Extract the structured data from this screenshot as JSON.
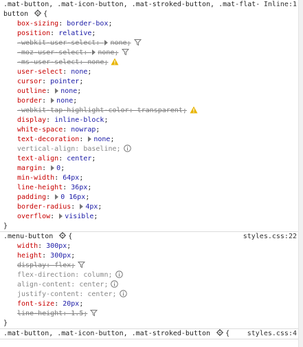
{
  "rules": [
    {
      "selector_line1": ".mat-button, .mat-icon-button, .mat-stroked-button, .mat-flat-",
      "selector_line2": "button",
      "source": "Inline:1",
      "open": "{",
      "close": "}",
      "declarations": [
        {
          "name": "box-sizing",
          "value": "border-box",
          "state": "normal",
          "expand": false,
          "icon": ""
        },
        {
          "name": "position",
          "value": "relative",
          "state": "normal",
          "expand": false,
          "icon": ""
        },
        {
          "name": "-webkit-user-select",
          "value": "none",
          "state": "struck",
          "expand": true,
          "icon": "filter-icon"
        },
        {
          "name": "-moz-user-select",
          "value": "none",
          "state": "struck",
          "expand": true,
          "icon": "filter-icon"
        },
        {
          "name": "-ms-user-select",
          "value": "none",
          "state": "struck",
          "expand": false,
          "icon": "warning-icon"
        },
        {
          "name": "user-select",
          "value": "none",
          "state": "normal",
          "expand": false,
          "icon": ""
        },
        {
          "name": "cursor",
          "value": "pointer",
          "state": "normal",
          "expand": false,
          "icon": ""
        },
        {
          "name": "outline",
          "value": "none",
          "state": "normal",
          "expand": true,
          "icon": ""
        },
        {
          "name": "border",
          "value": "none",
          "state": "normal",
          "expand": true,
          "icon": ""
        },
        {
          "name": "-webkit-tap-highlight-color",
          "value": "transparent",
          "state": "struck",
          "expand": false,
          "icon": "warning-icon"
        },
        {
          "name": "display",
          "value": "inline-block",
          "state": "normal",
          "expand": false,
          "icon": ""
        },
        {
          "name": "white-space",
          "value": "nowrap",
          "state": "normal",
          "expand": false,
          "icon": ""
        },
        {
          "name": "text-decoration",
          "value": "none",
          "state": "normal",
          "expand": true,
          "icon": ""
        },
        {
          "name": "vertical-align",
          "value": "baseline",
          "state": "dim",
          "expand": false,
          "icon": "info-icon"
        },
        {
          "name": "text-align",
          "value": "center",
          "state": "normal",
          "expand": false,
          "icon": ""
        },
        {
          "name": "margin",
          "value": "0",
          "state": "normal",
          "expand": true,
          "icon": ""
        },
        {
          "name": "min-width",
          "value": "64px",
          "state": "normal",
          "expand": false,
          "icon": ""
        },
        {
          "name": "line-height",
          "value": "36px",
          "state": "normal",
          "expand": false,
          "icon": ""
        },
        {
          "name": "padding",
          "value": "0 16px",
          "state": "normal",
          "expand": true,
          "icon": ""
        },
        {
          "name": "border-radius",
          "value": "4px",
          "state": "normal",
          "expand": true,
          "icon": ""
        },
        {
          "name": "overflow",
          "value": "visible",
          "state": "normal",
          "expand": true,
          "icon": ""
        }
      ]
    },
    {
      "selector_line1": ".menu-button",
      "selector_line2": "",
      "source": "styles.css:22",
      "open": "{",
      "close": "}",
      "declarations": [
        {
          "name": "width",
          "value": "300px",
          "state": "normal",
          "expand": false,
          "icon": ""
        },
        {
          "name": "height",
          "value": "300px",
          "state": "normal",
          "expand": false,
          "icon": ""
        },
        {
          "name": "display",
          "value": "flex",
          "state": "struck",
          "expand": false,
          "icon": "filter-icon"
        },
        {
          "name": "flex-direction",
          "value": "column",
          "state": "dim",
          "expand": false,
          "icon": "info-icon"
        },
        {
          "name": "align-content",
          "value": "center",
          "state": "dim",
          "expand": false,
          "icon": "info-icon"
        },
        {
          "name": "justify-content",
          "value": "center",
          "state": "dim",
          "expand": false,
          "icon": "info-icon"
        },
        {
          "name": "font-size",
          "value": "20px",
          "state": "normal",
          "expand": false,
          "icon": ""
        },
        {
          "name": "line-height",
          "value": "1.5",
          "state": "struck",
          "expand": false,
          "icon": "filter-icon"
        }
      ]
    },
    {
      "selector_line1": ".mat-button, .mat-icon-button, .mat-stroked-button",
      "selector_line2": "",
      "source": "styles.css:4",
      "open": "{",
      "close": "",
      "declarations": []
    }
  ],
  "colors": {
    "property": "#c80000",
    "value": "#1a1aa6",
    "warning": "#e8b400"
  }
}
